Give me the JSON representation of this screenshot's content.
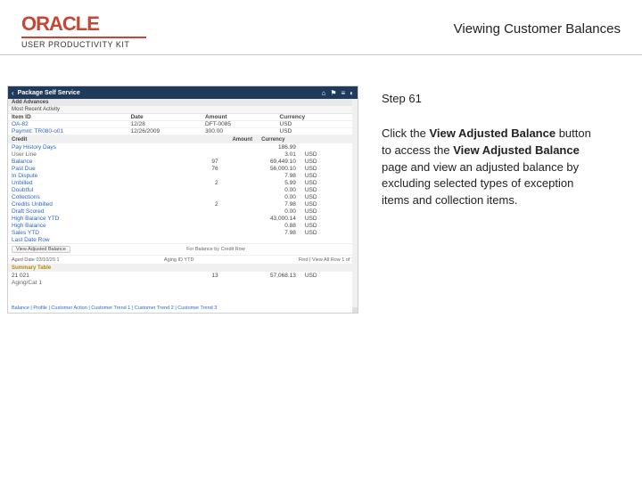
{
  "header": {
    "brand": "ORACLE",
    "upk": "USER PRODUCTIVITY KIT",
    "title": "Viewing Customer Balances"
  },
  "instruction": {
    "step": "Step 61",
    "text1": "Click the ",
    "bold1": "View Adjusted Balance",
    "text2": " button to access the ",
    "bold2": "View Adjusted Balance",
    "text3": " page and view an adjusted balance by excluding selected types of exception items and collection items."
  },
  "app": {
    "back": "‹",
    "title": "Package Self Service",
    "sub1": "Add Advances",
    "sub2": "Most Recent Activity",
    "cols": {
      "c1": "Item ID",
      "c2": "Date",
      "c3": "Amount",
      "c4": "Currency"
    },
    "rows": [
      {
        "c1": "OA-82",
        "c2": "12/28",
        "c3": "DFT-0085",
        "c4": "USD"
      },
      {
        "c1": "Paymnt: TR080-o01",
        "c2": "12/26/2009",
        "c3": "300.00",
        "c4": "USD"
      }
    ],
    "sec_hdr": {
      "s1": "Credit",
      "s2": "Amount",
      "s3": "Currency"
    },
    "pay_hist": "Pay History Days",
    "user_line": "User Line",
    "balances": [
      {
        "label": "Balance",
        "qty": "97",
        "amt": "69,449.10",
        "cur": "USD"
      },
      {
        "label": "Past Due",
        "qty": "76",
        "amt": "56,000.10",
        "cur": "USD"
      },
      {
        "label": "In Dispute",
        "qty": "",
        "amt": "7.98",
        "cur": "USD"
      },
      {
        "label": "Unbilled",
        "qty": "2",
        "amt": "5.99",
        "cur": "USD"
      },
      {
        "label": "Doubtful",
        "qty": "",
        "amt": "0.00",
        "cur": "USD"
      },
      {
        "label": "Collections",
        "qty": "",
        "amt": "0.00",
        "cur": "USD"
      },
      {
        "label": "Credits Unbilled",
        "qty": "2",
        "amt": "7.98",
        "cur": "USD"
      },
      {
        "label": "Draft Scored",
        "qty": "",
        "amt": "0.00",
        "cur": "USD"
      },
      {
        "label": "High Balance YTD",
        "qty": "",
        "amt": "43,000.14",
        "cur": "USD"
      },
      {
        "label": "High Balance",
        "qty": "",
        "amt": "0.88",
        "cur": "USD"
      },
      {
        "label": "Sales YTD",
        "qty": "",
        "amt": "7.98",
        "cur": "USD"
      }
    ],
    "last_date": "Last Date Row",
    "btn": "View Adjusted Balance",
    "for_balance": "For Balance by Credit Row",
    "aged": {
      "left": "Aged Date  03/10/20 1",
      "mid": "Aging ID  YTD",
      "right": "Find | View All    Row    1  of  1"
    },
    "summary": "Summary Table",
    "sum_row": {
      "c1": "21 021",
      "c2": "13",
      "c3": "57,068.13",
      "c4": "USD"
    },
    "aging_cat": "Aging/Cat 1",
    "footer": "Balance | Profile | Customer Action | Customer Trend 1 | Customer Trend 2 | Customer Trend 3"
  }
}
